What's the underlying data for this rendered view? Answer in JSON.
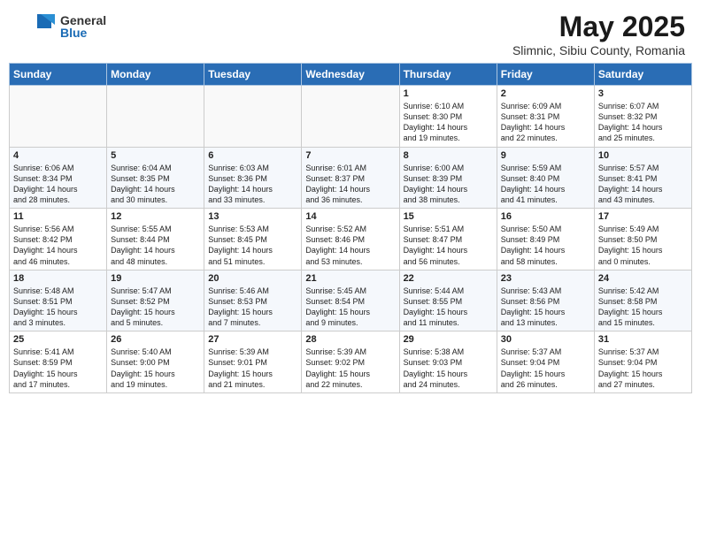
{
  "header": {
    "logo_general": "General",
    "logo_blue": "Blue",
    "main_title": "May 2025",
    "subtitle": "Slimnic, Sibiu County, Romania"
  },
  "weekdays": [
    "Sunday",
    "Monday",
    "Tuesday",
    "Wednesday",
    "Thursday",
    "Friday",
    "Saturday"
  ],
  "weeks": [
    [
      {
        "day": "",
        "info": ""
      },
      {
        "day": "",
        "info": ""
      },
      {
        "day": "",
        "info": ""
      },
      {
        "day": "",
        "info": ""
      },
      {
        "day": "1",
        "info": "Sunrise: 6:10 AM\nSunset: 8:30 PM\nDaylight: 14 hours\nand 19 minutes."
      },
      {
        "day": "2",
        "info": "Sunrise: 6:09 AM\nSunset: 8:31 PM\nDaylight: 14 hours\nand 22 minutes."
      },
      {
        "day": "3",
        "info": "Sunrise: 6:07 AM\nSunset: 8:32 PM\nDaylight: 14 hours\nand 25 minutes."
      }
    ],
    [
      {
        "day": "4",
        "info": "Sunrise: 6:06 AM\nSunset: 8:34 PM\nDaylight: 14 hours\nand 28 minutes."
      },
      {
        "day": "5",
        "info": "Sunrise: 6:04 AM\nSunset: 8:35 PM\nDaylight: 14 hours\nand 30 minutes."
      },
      {
        "day": "6",
        "info": "Sunrise: 6:03 AM\nSunset: 8:36 PM\nDaylight: 14 hours\nand 33 minutes."
      },
      {
        "day": "7",
        "info": "Sunrise: 6:01 AM\nSunset: 8:37 PM\nDaylight: 14 hours\nand 36 minutes."
      },
      {
        "day": "8",
        "info": "Sunrise: 6:00 AM\nSunset: 8:39 PM\nDaylight: 14 hours\nand 38 minutes."
      },
      {
        "day": "9",
        "info": "Sunrise: 5:59 AM\nSunset: 8:40 PM\nDaylight: 14 hours\nand 41 minutes."
      },
      {
        "day": "10",
        "info": "Sunrise: 5:57 AM\nSunset: 8:41 PM\nDaylight: 14 hours\nand 43 minutes."
      }
    ],
    [
      {
        "day": "11",
        "info": "Sunrise: 5:56 AM\nSunset: 8:42 PM\nDaylight: 14 hours\nand 46 minutes."
      },
      {
        "day": "12",
        "info": "Sunrise: 5:55 AM\nSunset: 8:44 PM\nDaylight: 14 hours\nand 48 minutes."
      },
      {
        "day": "13",
        "info": "Sunrise: 5:53 AM\nSunset: 8:45 PM\nDaylight: 14 hours\nand 51 minutes."
      },
      {
        "day": "14",
        "info": "Sunrise: 5:52 AM\nSunset: 8:46 PM\nDaylight: 14 hours\nand 53 minutes."
      },
      {
        "day": "15",
        "info": "Sunrise: 5:51 AM\nSunset: 8:47 PM\nDaylight: 14 hours\nand 56 minutes."
      },
      {
        "day": "16",
        "info": "Sunrise: 5:50 AM\nSunset: 8:49 PM\nDaylight: 14 hours\nand 58 minutes."
      },
      {
        "day": "17",
        "info": "Sunrise: 5:49 AM\nSunset: 8:50 PM\nDaylight: 15 hours\nand 0 minutes."
      }
    ],
    [
      {
        "day": "18",
        "info": "Sunrise: 5:48 AM\nSunset: 8:51 PM\nDaylight: 15 hours\nand 3 minutes."
      },
      {
        "day": "19",
        "info": "Sunrise: 5:47 AM\nSunset: 8:52 PM\nDaylight: 15 hours\nand 5 minutes."
      },
      {
        "day": "20",
        "info": "Sunrise: 5:46 AM\nSunset: 8:53 PM\nDaylight: 15 hours\nand 7 minutes."
      },
      {
        "day": "21",
        "info": "Sunrise: 5:45 AM\nSunset: 8:54 PM\nDaylight: 15 hours\nand 9 minutes."
      },
      {
        "day": "22",
        "info": "Sunrise: 5:44 AM\nSunset: 8:55 PM\nDaylight: 15 hours\nand 11 minutes."
      },
      {
        "day": "23",
        "info": "Sunrise: 5:43 AM\nSunset: 8:56 PM\nDaylight: 15 hours\nand 13 minutes."
      },
      {
        "day": "24",
        "info": "Sunrise: 5:42 AM\nSunset: 8:58 PM\nDaylight: 15 hours\nand 15 minutes."
      }
    ],
    [
      {
        "day": "25",
        "info": "Sunrise: 5:41 AM\nSunset: 8:59 PM\nDaylight: 15 hours\nand 17 minutes."
      },
      {
        "day": "26",
        "info": "Sunrise: 5:40 AM\nSunset: 9:00 PM\nDaylight: 15 hours\nand 19 minutes."
      },
      {
        "day": "27",
        "info": "Sunrise: 5:39 AM\nSunset: 9:01 PM\nDaylight: 15 hours\nand 21 minutes."
      },
      {
        "day": "28",
        "info": "Sunrise: 5:39 AM\nSunset: 9:02 PM\nDaylight: 15 hours\nand 22 minutes."
      },
      {
        "day": "29",
        "info": "Sunrise: 5:38 AM\nSunset: 9:03 PM\nDaylight: 15 hours\nand 24 minutes."
      },
      {
        "day": "30",
        "info": "Sunrise: 5:37 AM\nSunset: 9:04 PM\nDaylight: 15 hours\nand 26 minutes."
      },
      {
        "day": "31",
        "info": "Sunrise: 5:37 AM\nSunset: 9:04 PM\nDaylight: 15 hours\nand 27 minutes."
      }
    ]
  ]
}
